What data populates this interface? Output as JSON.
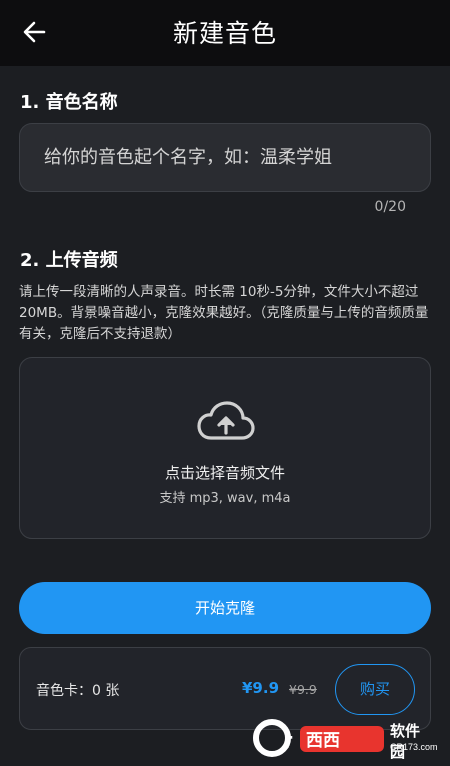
{
  "header": {
    "title": "新建音色",
    "back_icon": "arrow-left-icon"
  },
  "section1": {
    "title": "1. 音色名称",
    "name_placeholder": "给你的音色起个名字，如：温柔学姐",
    "name_value": "",
    "counter": "0/20"
  },
  "section2": {
    "title": "2. 上传音频",
    "description": "请上传一段清晰的人声录音。时长需 10秒-5分钟，文件大小不超过 20MB。背景噪音越小，克隆效果越好。（克隆质量与上传的音频质量有关，克隆后不支持退款）",
    "upload_icon": "cloud-upload-icon",
    "upload_label": "点击选择音频文件",
    "upload_formats": "支持 mp3, wav, m4a"
  },
  "start_button": "开始克隆",
  "card": {
    "label": "音色卡：0 张",
    "price": "¥9.9",
    "old_price": "¥9.9",
    "buy_button": "购买"
  },
  "watermark": {
    "brand": "软件园",
    "domain": "CR173.com",
    "logo_text": "Cr西西"
  },
  "colors": {
    "accent": "#2196f3",
    "background": "#1c1e22",
    "header": "#0d0d0f",
    "panel": "#22242a"
  }
}
